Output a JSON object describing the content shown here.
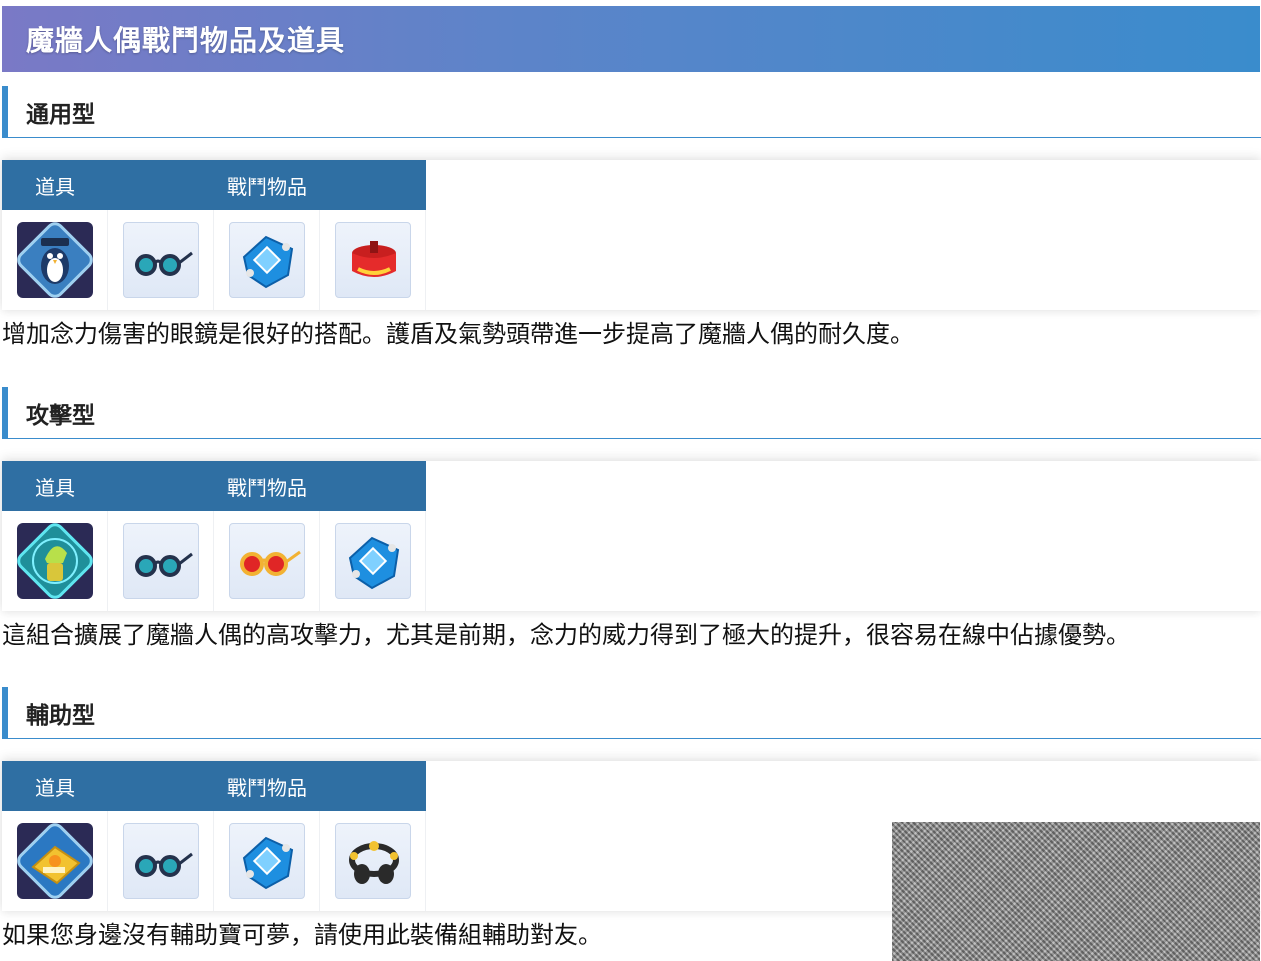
{
  "page": {
    "title": "魔牆人偶戰鬥物品及道具"
  },
  "table_headers": {
    "item": "道具",
    "battle_items": "戰鬥物品"
  },
  "sections": [
    {
      "heading": "通用型",
      "item_icon": "penguin-item-icon",
      "battle_icons": [
        "wise-glasses-icon",
        "focus-band-shield-icon",
        "muscle-band-icon"
      ],
      "description": "增加念力傷害的眼鏡是很好的搭配。護盾及氣勢頭帶進一步提高了魔牆人偶的耐久度。"
    },
    {
      "heading": "攻擊型",
      "item_icon": "x-attack-item-icon",
      "battle_icons": [
        "wise-glasses-icon",
        "choice-specs-icon",
        "focus-band-shield-icon"
      ],
      "description": "這組合擴展了魔牆人偶的高攻擊力，尤其是前期，念力的威力得到了極大的提升，很容易在線中佔據優勢。"
    },
    {
      "heading": "輔助型",
      "item_icon": "ejecting-button-item-icon",
      "battle_icons": [
        "wise-glasses-icon",
        "focus-band-shield-icon",
        "exp-share-icon"
      ],
      "description": "如果您身邊沒有輔助寶可夢，請使用此裝備組輔助對友。"
    }
  ]
}
